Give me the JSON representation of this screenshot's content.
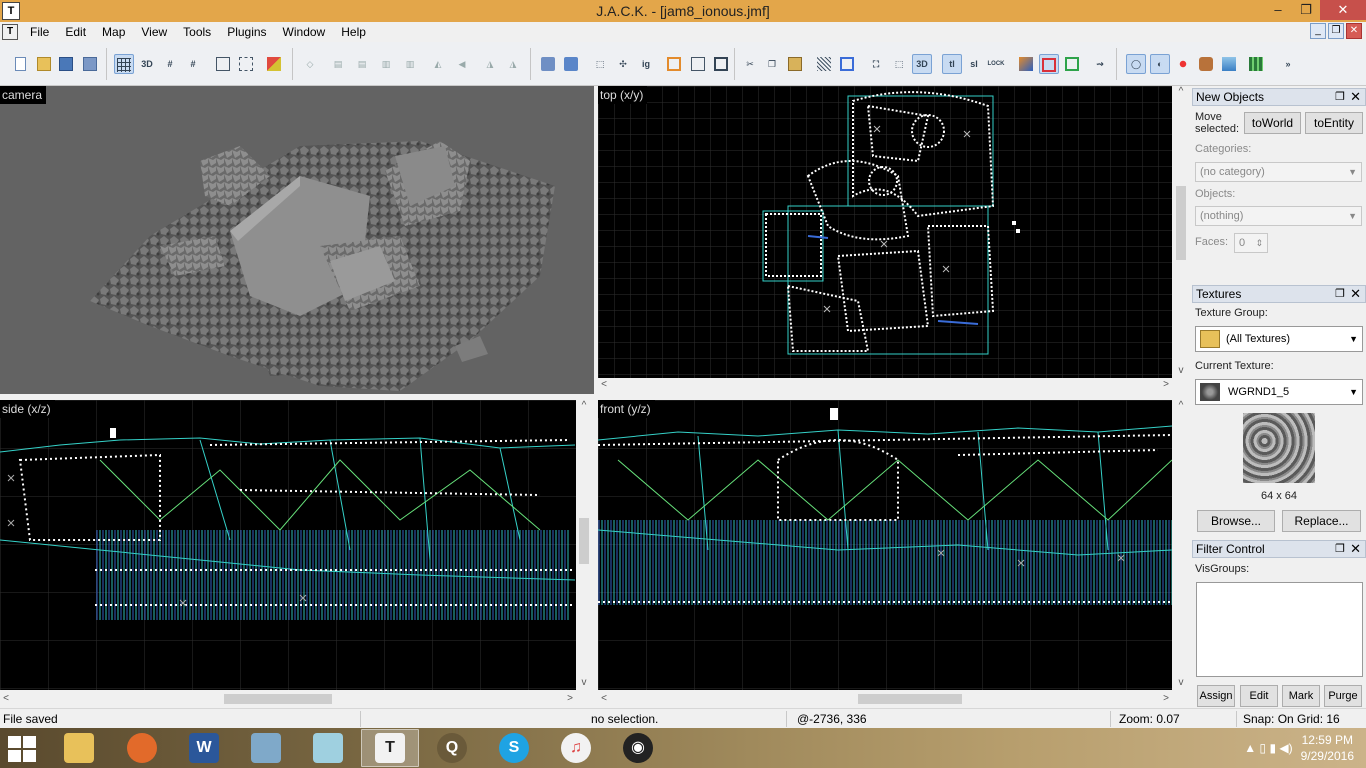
{
  "window": {
    "title": "J.A.C.K. - [jam8_ionous.jmf]",
    "app_icon": "T",
    "controls": {
      "minimize": "‒",
      "restore": "❐",
      "close": "✕"
    }
  },
  "menu": {
    "doc_icon": "T",
    "items": [
      "File",
      "Edit",
      "Map",
      "View",
      "Tools",
      "Plugins",
      "Window",
      "Help"
    ],
    "mdi": {
      "minimize": "_",
      "restore": "❐",
      "close": "✕"
    }
  },
  "toolbar": {
    "grid3d_label": "3D",
    "ig_label": "ig",
    "cam3d_label": "3D",
    "tl_label": "tl",
    "sl_label": "sl",
    "lock_label": "LOCK",
    "more": "»"
  },
  "viewports": {
    "camera": "camera",
    "top": "top (x/y)",
    "side": "side (x/z)",
    "front": "front (y/z)"
  },
  "scroll": {
    "left": "<",
    "right": ">",
    "up": "^",
    "down": "v"
  },
  "panels": {
    "pin": "❐",
    "close": "✕",
    "new_objects": {
      "title": "New Objects",
      "move_label": "Move\nselected:",
      "to_world": "toWorld",
      "to_entity": "toEntity",
      "categories_label": "Categories:",
      "categories_value": "(no category)",
      "objects_label": "Objects:",
      "objects_value": "(nothing)",
      "faces_label": "Faces:",
      "faces_value": "0"
    },
    "textures": {
      "title": "Textures",
      "group_label": "Texture Group:",
      "group_value": "(All Textures)",
      "current_label": "Current Texture:",
      "current_value": "WGRND1_5",
      "size": "64 x 64",
      "browse": "Browse...",
      "replace": "Replace..."
    },
    "filter": {
      "title": "Filter Control",
      "visgroups_label": "VisGroups:",
      "assign": "Assign",
      "edit": "Edit",
      "mark": "Mark",
      "purge": "Purge"
    }
  },
  "status": {
    "message": "File saved",
    "selection": "no selection.",
    "coords": "@-2736, 336",
    "zoom": "Zoom: 0.07",
    "snap": "Snap: On Grid: 16"
  },
  "taskbar": {
    "clock_time": "12:59 PM",
    "clock_date": "9/29/2016",
    "tray_icons": "▲ ▯ ▮ ◀)",
    "apps": [
      "file-explorer",
      "firefox",
      "word",
      "hdd",
      "glass",
      "jack",
      "quake",
      "skype",
      "itunes",
      "obs"
    ]
  },
  "colors": {
    "title_bar": "#e3a64a",
    "close_red": "#c7504b",
    "grid_line": "#2f2f2f",
    "brush_white": "#ffffff",
    "brush_cyan": "#35d1c8",
    "brush_green": "#66e07a",
    "brush_blue": "#3a6cd8"
  }
}
